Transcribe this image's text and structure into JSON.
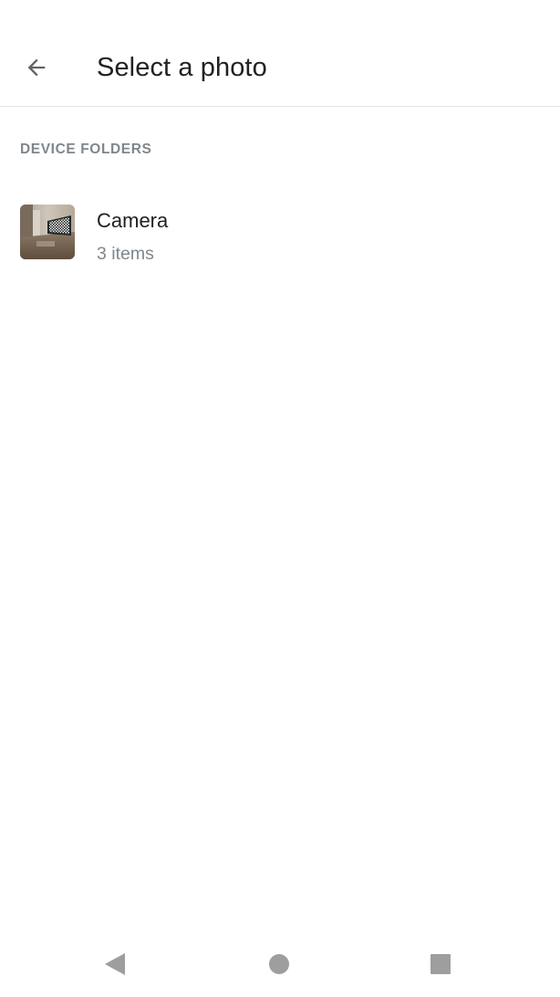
{
  "app_bar": {
    "back_icon": "arrow-back-icon",
    "title": "Select a photo"
  },
  "section": {
    "header": "DEVICE FOLDERS"
  },
  "folders": [
    {
      "name": "Camera",
      "count": "3 items",
      "thumbnail": "room-photo-thumbnail"
    }
  ],
  "nav_bar": {
    "back_icon": "triangle-back-icon",
    "home_icon": "circle-home-icon",
    "recents_icon": "square-recents-icon"
  },
  "colors": {
    "background": "#ffffff",
    "title_text": "#202124",
    "secondary_text": "#80868b",
    "divider": "#e6e6e6",
    "nav_icons": "#9e9e9e"
  }
}
